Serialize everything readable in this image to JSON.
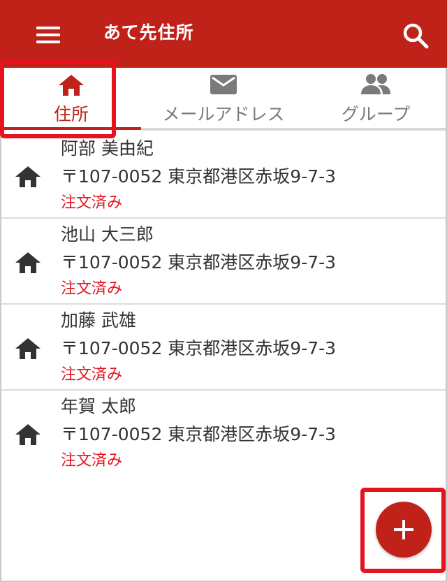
{
  "app_bar": {
    "title": "あて先住所",
    "menu_icon": "menu-icon",
    "search_icon": "search-icon",
    "color": "#c0221a"
  },
  "tabs": [
    {
      "label": "住所",
      "icon": "home-icon",
      "active": true
    },
    {
      "label": "メールアドレス",
      "icon": "mail-icon",
      "active": false
    },
    {
      "label": "グループ",
      "icon": "group-icon",
      "active": false
    }
  ],
  "addresses": [
    {
      "name": "阿部 美由紀",
      "address": "〒107-0052 東京都港区赤坂9-7-3",
      "status": "注文済み"
    },
    {
      "name": "池山 大三郎",
      "address": "〒107-0052 東京都港区赤坂9-7-3",
      "status": "注文済み"
    },
    {
      "name": "加藤 武雄",
      "address": "〒107-0052 東京都港区赤坂9-7-3",
      "status": "注文済み"
    },
    {
      "name": "年賀 太郎",
      "address": "〒107-0052 東京都港区赤坂9-7-3",
      "status": "注文済み"
    }
  ],
  "fab": {
    "icon": "plus-icon"
  },
  "colors": {
    "accent": "#c0221a",
    "status": "#e5131e",
    "highlight": "#e5131e"
  }
}
